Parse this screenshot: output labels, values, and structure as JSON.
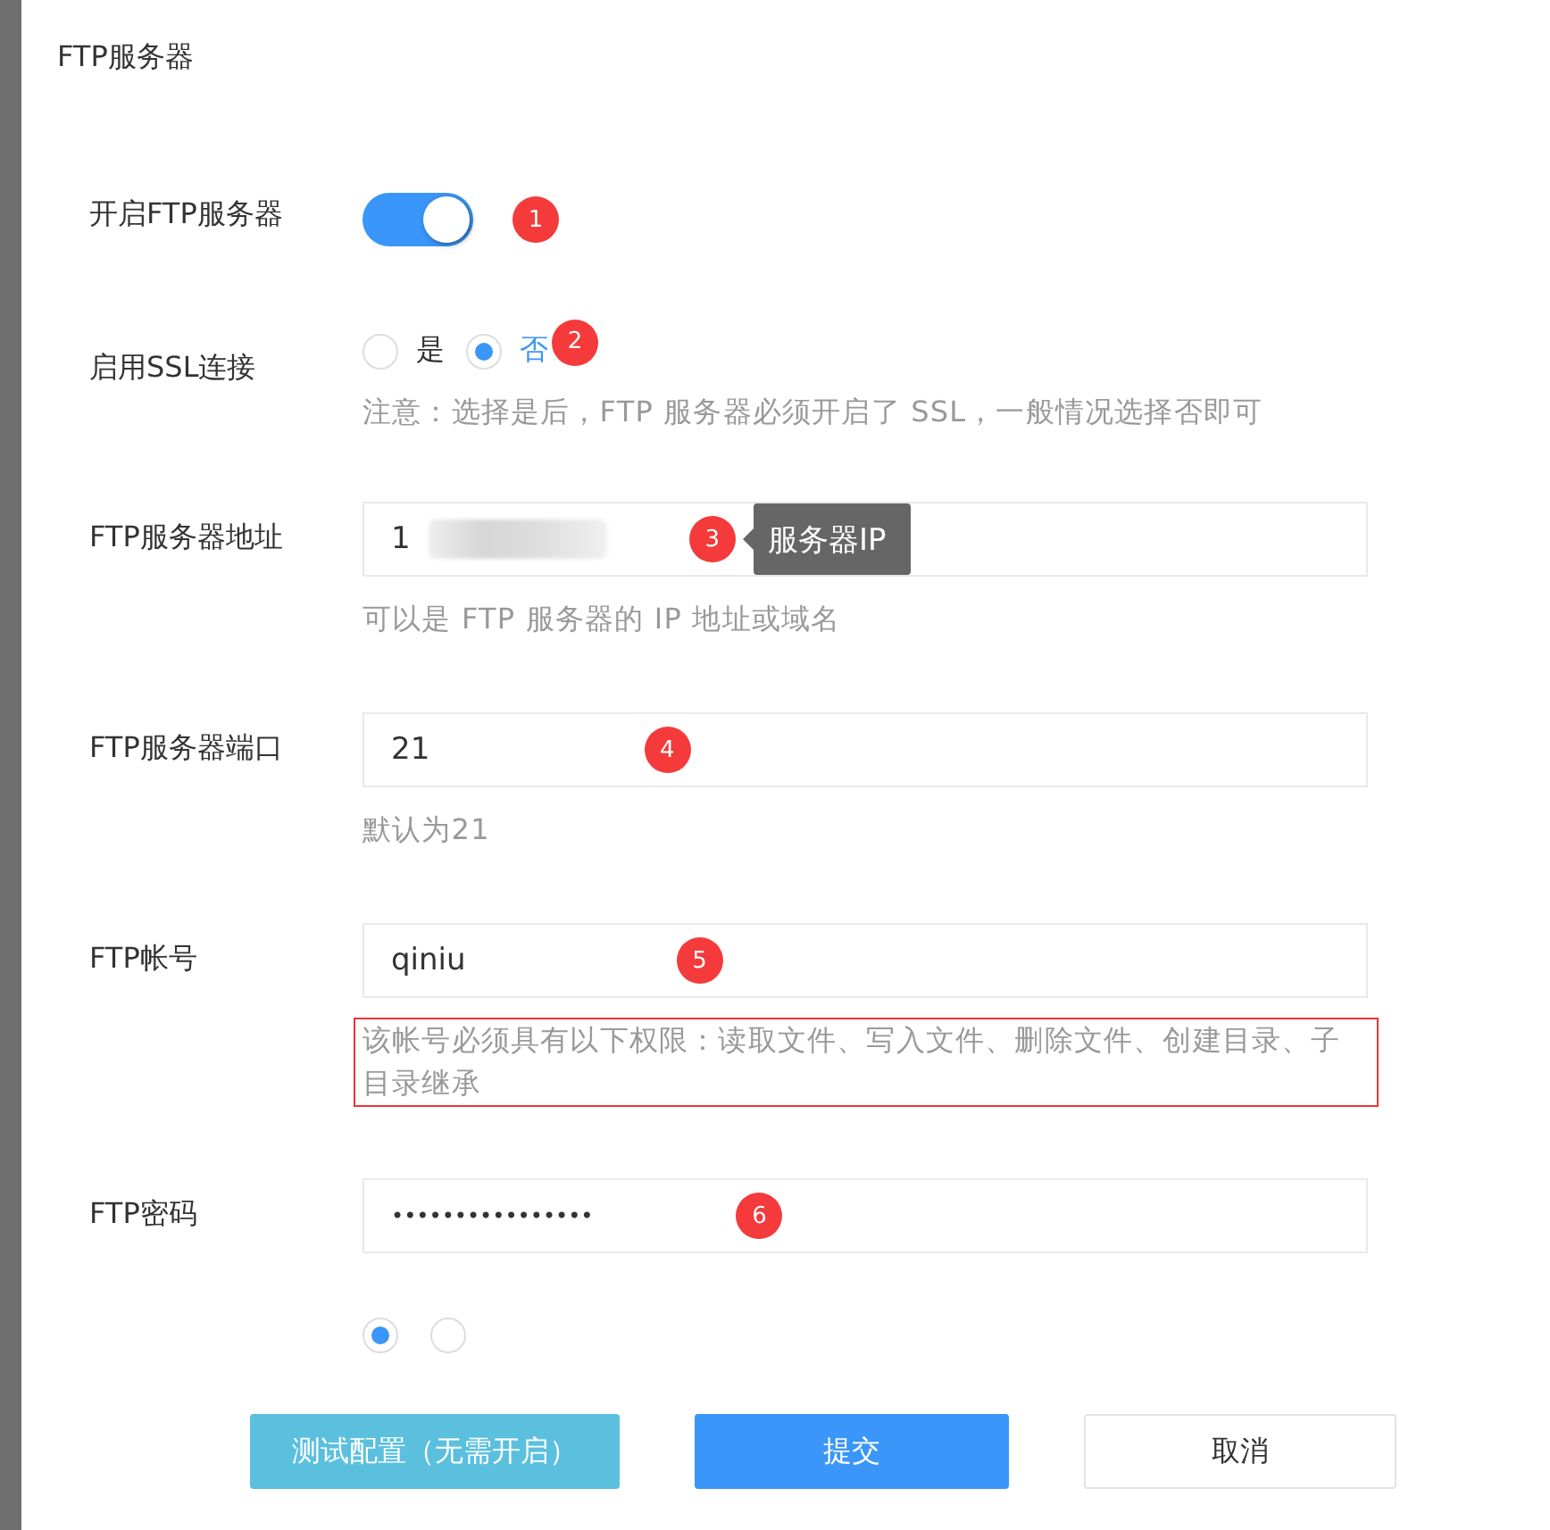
{
  "dialog": {
    "title": "FTP服务器"
  },
  "fields": [
    {
      "kind": "switch",
      "label": "开启FTP服务器",
      "on": true,
      "badge": "1"
    },
    {
      "kind": "radio",
      "label": "启用SSL连接",
      "options": [
        {
          "label": "是",
          "selected": false
        },
        {
          "label": "否",
          "selected": true
        }
      ],
      "badge": "2",
      "hint": "注意：选择是后，FTP 服务器必须开启了 SSL，一般情况选择否即可",
      "highlighted": false
    },
    {
      "kind": "input",
      "label": "FTP服务器地址",
      "value": "1",
      "redacted": true,
      "badge": "3",
      "tooltip": "服务器IP",
      "hint": "可以是 FTP 服务器的 IP 地址或域名",
      "highlighted": false
    },
    {
      "kind": "input",
      "label": "FTP服务器端口",
      "value": "21",
      "badge": "4",
      "hint": "默认为21",
      "highlighted": false
    },
    {
      "kind": "input",
      "label": "FTP帐号",
      "value": "qiniu",
      "badge": "5",
      "hint": "该帐号必须具有以下权限：读取文件、写入文件、删除文件、创建目录、子目录继承",
      "highlighted": true
    },
    {
      "kind": "password",
      "label": "FTP密码",
      "value": "••••••••••••••••",
      "badge": "6"
    },
    {
      "kind": "radio-cut",
      "options": [
        {
          "selected": true
        },
        {
          "selected": false
        }
      ]
    }
  ],
  "buttons": [
    {
      "label": "测试配置（无需开启）",
      "kind": "info"
    },
    {
      "label": "提交",
      "kind": "primary"
    },
    {
      "label": "取消",
      "kind": "default"
    }
  ]
}
